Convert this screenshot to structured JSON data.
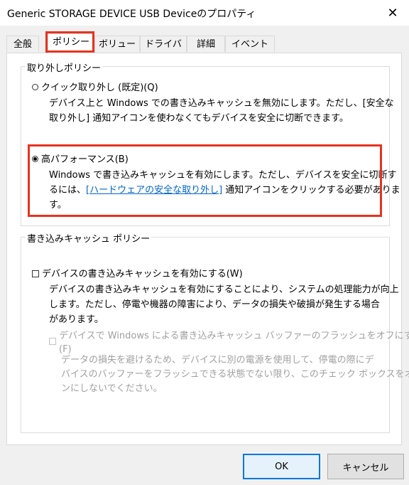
{
  "window": {
    "title": "Generic STORAGE DEVICE USB Deviceのプロパティ",
    "close_glyph": "✕"
  },
  "tabs": [
    {
      "label": "全般"
    },
    {
      "label": "ポリシー",
      "selected": true
    },
    {
      "label": "ボリューム"
    },
    {
      "label": "ドライバー"
    },
    {
      "label": "詳細"
    },
    {
      "label": "イベント"
    }
  ],
  "removal_policy": {
    "title": "取り外しポリシー",
    "quick_removal": {
      "label": "クイック取り外し (既定)(Q)",
      "selected": false,
      "desc_line1": "デバイス上と Windows での書き込みキャッシュを無効にします。ただし、[安全な",
      "desc_line2": "取り外し] 通知アイコンを使わなくてもデバイスを安全に切断できます。"
    },
    "better_performance": {
      "label": "高パフォーマンス(B)",
      "selected": true,
      "desc_line1": "Windows で書き込みキャッシュを有効にします。ただし、デバイスを安全に切断す",
      "desc_line2_prefix": "るには、",
      "desc_line2_link": "[ハードウェアの安全な取り外し]",
      "desc_line2_suffix": " 通知アイコンをクリックする必要がありま",
      "desc_line3": "す。"
    }
  },
  "write_cache_policy": {
    "title": "書き込みキャッシュ ポリシー",
    "enable_cache": {
      "label": "デバイスの書き込みキャッシュを有効にする(W)",
      "checked": false,
      "desc_line1": "デバイスの書き込みキャッシュを有効にすることにより、システムの処理能力が向上",
      "desc_line2": "します。ただし、停電や機器の障害により、データの損失や破損が発生する場合",
      "desc_line3": "があります。"
    },
    "turn_off_flush": {
      "label_line1": "デバイスで Windows による書き込みキャッシュ バッファーのフラッシュをオフにする",
      "label_line2": "(F)",
      "checked": false,
      "enabled": false,
      "desc_line1": "データの損失を避けるため、デバイスに別の電源を使用して、停電の際にデ",
      "desc_line2": "バイスのバッファーをフラッシュできる状態でない限り、このチェック ボックスをオ",
      "desc_line3": "ンにしないでください。"
    }
  },
  "buttons": {
    "ok": "OK",
    "cancel": "キャンセル"
  },
  "colors": {
    "highlight": "#e8321e",
    "link": "#0066cc",
    "accent": "#0078d7"
  }
}
